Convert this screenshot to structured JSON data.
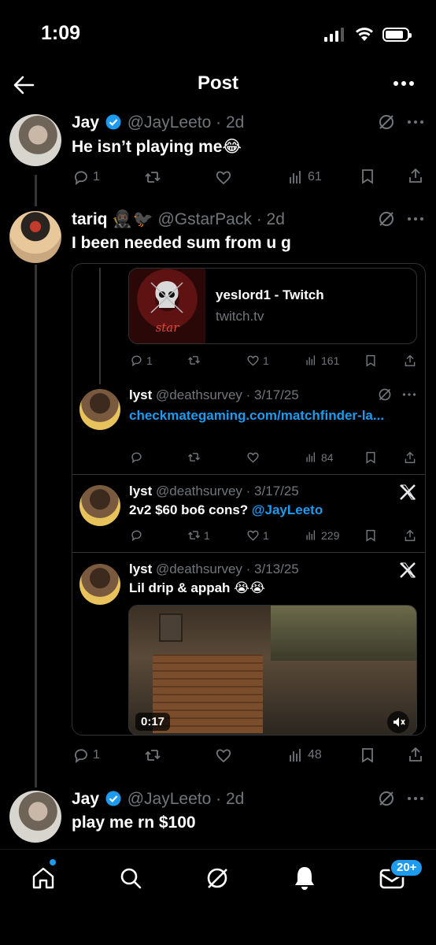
{
  "status_bar": {
    "time": "1:09"
  },
  "header": {
    "title": "Post"
  },
  "post1": {
    "name": "Jay",
    "handle": "@JayLeeto",
    "time": "· 2d",
    "text": "He isn’t playing me😂",
    "replies": "1",
    "likes": "",
    "views": "61"
  },
  "post2": {
    "name": "tariq 🥷🏿🐦‍⬛",
    "handle": "@GstarPack",
    "time": "· 2d",
    "text": "I been needed sum from u g",
    "link_card": {
      "title": "yeslord1 - Twitch",
      "domain": "twitch.tv",
      "thumb_text": "star"
    },
    "link_actions": {
      "replies": "1",
      "likes": "1",
      "views": "161"
    },
    "quotes": [
      {
        "name": "lyst",
        "handle": "@deathsurvey",
        "time": "· 3/17/25",
        "link": "checkmategaming.com/matchfinder-la...",
        "replies": "",
        "reposts": "",
        "likes": "",
        "views": "84"
      },
      {
        "name": "lyst",
        "handle": "@deathsurvey",
        "time": "· 3/17/25",
        "text": "2v2 $60 bo6 cons?",
        "mention": "@JayLeeto",
        "replies": "",
        "reposts": "1",
        "likes": "1",
        "views": "229"
      },
      {
        "name": "lyst",
        "handle": "@deathsurvey",
        "time": "· 3/13/25",
        "text": "Lil drip & appah 😭😭",
        "video_time": "0:17"
      }
    ],
    "replies": "1",
    "views": "48"
  },
  "post3": {
    "name": "Jay",
    "handle": "@JayLeeto",
    "time": "· 2d",
    "text": "play me rn $100"
  },
  "tabbar": {
    "badge": "20+"
  },
  "colors": {
    "accent": "#1d9bf0",
    "muted": "#71767b",
    "background": "#000000"
  }
}
